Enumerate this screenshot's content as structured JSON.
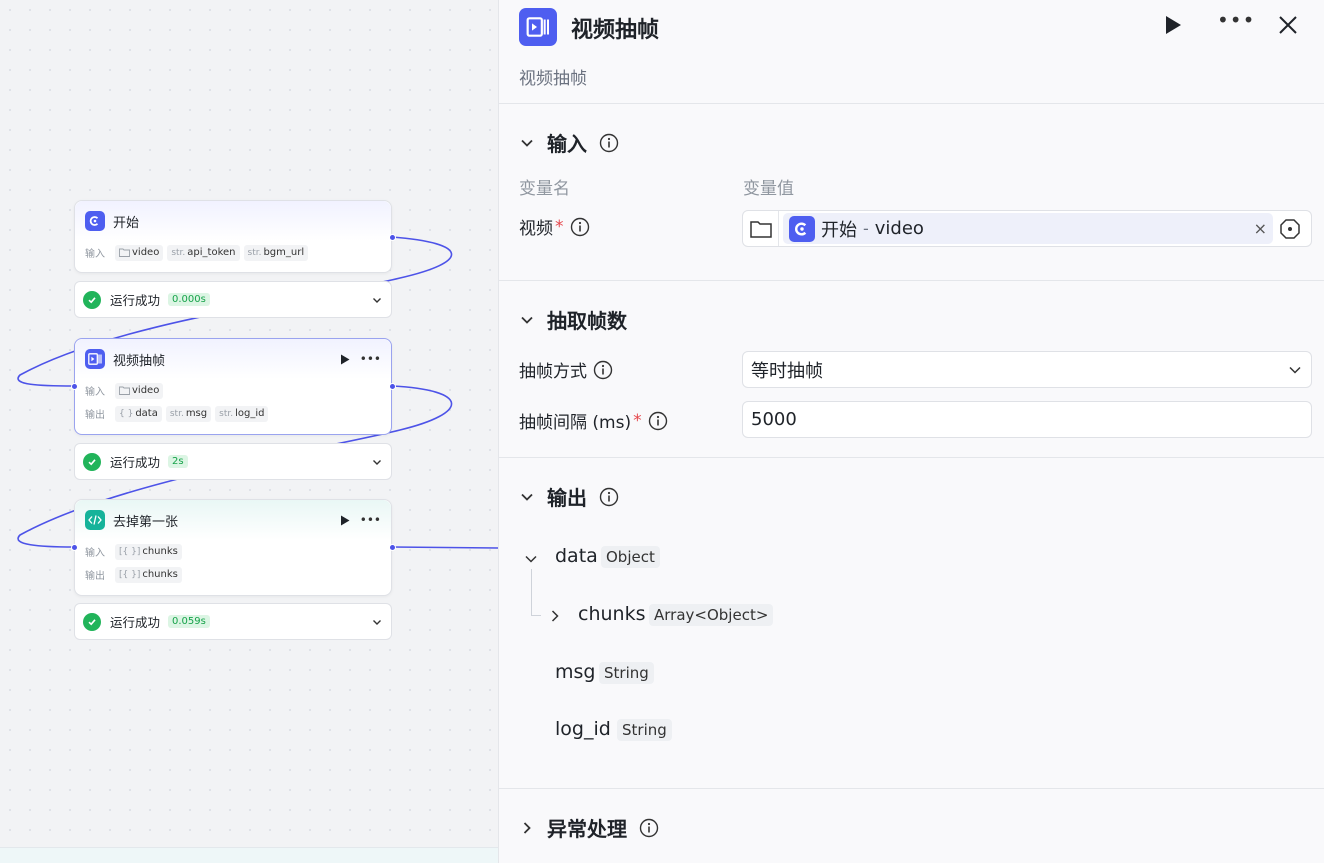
{
  "canvas": {
    "nodes": [
      {
        "title": "开始",
        "kind": "start",
        "rows": [
          {
            "label": "输入",
            "tags": [
              {
                "type": "",
                "name": "video",
                "icon": "folder"
              },
              {
                "type": "str.",
                "name": "api_token"
              },
              {
                "type": "str.",
                "name": "bgm_url"
              }
            ]
          }
        ],
        "status": {
          "label": "运行成功",
          "time": "0.000s"
        }
      },
      {
        "title": "视频抽帧",
        "kind": "video",
        "rows": [
          {
            "label": "输入",
            "tags": [
              {
                "type": "",
                "name": "video",
                "icon": "folder"
              }
            ]
          },
          {
            "label": "输出",
            "tags": [
              {
                "type": "{ }",
                "name": "data"
              },
              {
                "type": "str.",
                "name": "msg"
              },
              {
                "type": "str.",
                "name": "log_id"
              }
            ]
          }
        ],
        "status": {
          "label": "运行成功",
          "time": "2s"
        }
      },
      {
        "title": "去掉第一张",
        "kind": "code",
        "rows": [
          {
            "label": "输入",
            "tags": [
              {
                "type": "[{ }]",
                "name": "chunks"
              }
            ]
          },
          {
            "label": "输出",
            "tags": [
              {
                "type": "[{ }]",
                "name": "chunks"
              }
            ]
          }
        ],
        "status": {
          "label": "运行成功",
          "time": "0.059s"
        }
      }
    ]
  },
  "panel": {
    "title": "视频抽帧",
    "subtitle": "视频抽帧",
    "input": {
      "title": "输入",
      "col_name": "变量名",
      "col_value": "变量值",
      "video_label": "视频",
      "required_mark": "*",
      "ref_node": "开始",
      "ref_sep": "-",
      "ref_var": "video",
      "clear_glyph": "×"
    },
    "frames": {
      "title": "抽取帧数",
      "mode_label": "抽帧方式",
      "mode_value": "等时抽帧",
      "interval_label": "抽帧间隔 (ms)",
      "required_mark": "*",
      "interval_value": "5000"
    },
    "output": {
      "title": "输出",
      "items": [
        {
          "name": "data",
          "type": "Object"
        },
        {
          "name": "chunks",
          "type": "Array<Object>"
        },
        {
          "name": "msg",
          "type": "String"
        },
        {
          "name": "log_id",
          "type": "String"
        }
      ]
    },
    "exception": {
      "title": "异常处理"
    }
  },
  "colors": {
    "accent": "#4e5ef0",
    "code_node": "#16b39a",
    "success": "#21b45a",
    "edge": "#4d53e8",
    "required": "#e5484d"
  },
  "icons": {
    "start": "start-node-icon",
    "video": "video-frame-icon",
    "code": "code-icon",
    "run": "play-icon",
    "more": "more-icon",
    "close": "close-icon"
  }
}
